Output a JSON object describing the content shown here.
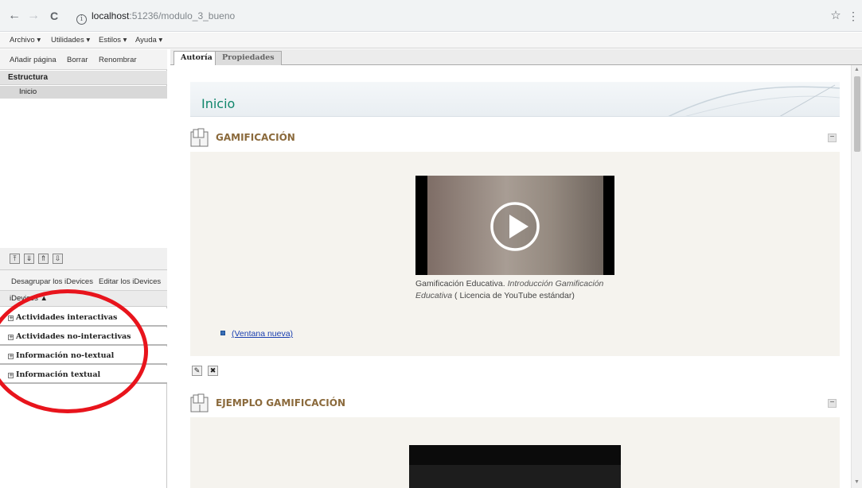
{
  "browser": {
    "url_host": "localhost",
    "url_path": ":51236/modulo_3_bueno",
    "back": "←",
    "forward": "→",
    "reload": "C",
    "star": "☆",
    "more": "⋮"
  },
  "menu": {
    "items": [
      "Archivo ▾",
      "Utilidades ▾",
      "Estilos ▾",
      "Ayuda ▾"
    ]
  },
  "left_panel": {
    "toolbar": [
      "Añadir página",
      "Borrar",
      "Renombrar"
    ],
    "structure_header": "Estructura",
    "tree_items": [
      "Inicio"
    ],
    "idevice_tools": [
      "Desagrupar los iDevices",
      "Editar los iDevices"
    ],
    "idevices_header": "iDevices ▲",
    "categories": [
      "Actividades interactivas",
      "Actividades no-interactivas",
      "Información no-textual",
      "Información textual"
    ]
  },
  "tabs": [
    "Autoría",
    "Propiedades"
  ],
  "content": {
    "page_title": "Inicio",
    "idevice1": {
      "title": "GAMIFICACIÓN",
      "caption_plain": "Gamificación Educativa. ",
      "caption_italic": "Introducción Gamificación Educativa",
      "caption_tail": " ( Licencia de YouTube estándar)",
      "link": "(Ventana nueva)"
    },
    "idevice2": {
      "title": "EJEMPLO GAMIFICACIÓN"
    },
    "collapse_symbol": "−"
  },
  "colors": {
    "page_title": "#10866b",
    "idevice_title": "#8b6a3c",
    "annotation": "#e8141c",
    "link": "#1a3fb0"
  }
}
